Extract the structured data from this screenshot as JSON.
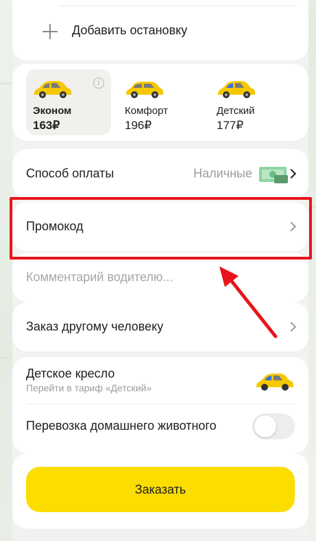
{
  "add_stop": {
    "label": "Добавить остановку",
    "icon": "plus-icon"
  },
  "tariffs": [
    {
      "name": "Эконом",
      "price": "163₽",
      "selected": true
    },
    {
      "name": "Комфорт",
      "price": "196₽",
      "selected": false
    },
    {
      "name": "Детский",
      "price": "177₽",
      "selected": false
    }
  ],
  "payment": {
    "label": "Способ оплаты",
    "value": "Наличные",
    "icon": "cash-icon"
  },
  "promo": {
    "label": "Промокод"
  },
  "comment": {
    "placeholder": "Комментарий водителю..."
  },
  "order_for_other": {
    "label": "Заказ другому человеку"
  },
  "child_seat": {
    "title": "Детское кресло",
    "subtitle": "Перейти в тариф «Детский»"
  },
  "pet": {
    "label": "Перевозка домашнего животного",
    "enabled": false
  },
  "order_button": {
    "label": "Заказать"
  },
  "colors": {
    "accent": "#fcdd00",
    "highlight": "#e8141b",
    "taxi_yellow": "#f5c800"
  }
}
